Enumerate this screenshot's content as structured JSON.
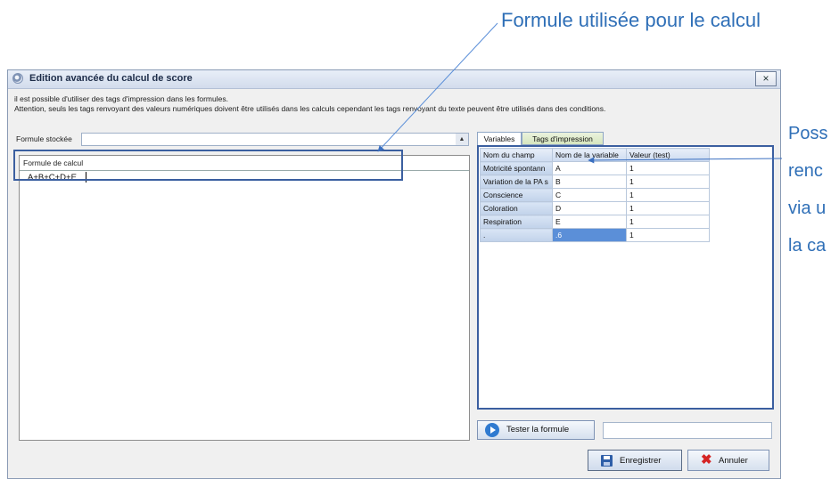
{
  "annotations": {
    "formula_callout": "Formule utilisée pour le calcul",
    "side_callout_lines": [
      "Poss",
      "renc",
      "via u",
      "la ca"
    ]
  },
  "window": {
    "title": "Edition avancée du calcul de score",
    "close_glyph": "×",
    "info_line1": "il est possible d'utiliser des tags d'impression dans les formules.",
    "info_line2": "Attention, seuls les tags renvoyant des valeurs numériques doivent être utilisés dans les calculs cependant les tags renvoyant du texte peuvent être utilisés dans des conditions."
  },
  "left_panel": {
    "stored_label": "Formule stockée",
    "stored_value": "",
    "stored_arrow": "▲",
    "formula_label": "Formule de calcul",
    "formula_value": "A+B+C+D+E"
  },
  "tabs": [
    "Variables",
    "Tags d'impression"
  ],
  "grid": {
    "columns": [
      "Nom du champ",
      "Nom de la variable",
      "Valeur (test)"
    ],
    "rows": [
      {
        "field": "Motricité spontann",
        "variable": "A",
        "value": "1"
      },
      {
        "field": "Variation de la PA s",
        "variable": "B",
        "value": "1"
      },
      {
        "field": "Conscience",
        "variable": "C",
        "value": "1"
      },
      {
        "field": "Coloration",
        "variable": "D",
        "value": "1"
      },
      {
        "field": "Respiration",
        "variable": "E",
        "value": "1"
      },
      {
        "field": ".",
        "variable": ".6",
        "value": "1"
      }
    ]
  },
  "buttons": {
    "test_label": "Tester la formule",
    "test_result": "",
    "save_label": "Enregistrer",
    "cancel_label": "Annuler",
    "cancel_glyph": "✖"
  },
  "colors": {
    "callout": "#2f6fb7",
    "highlight_border": "#3b5fa0",
    "selected_cell": "#5b8fd8"
  }
}
